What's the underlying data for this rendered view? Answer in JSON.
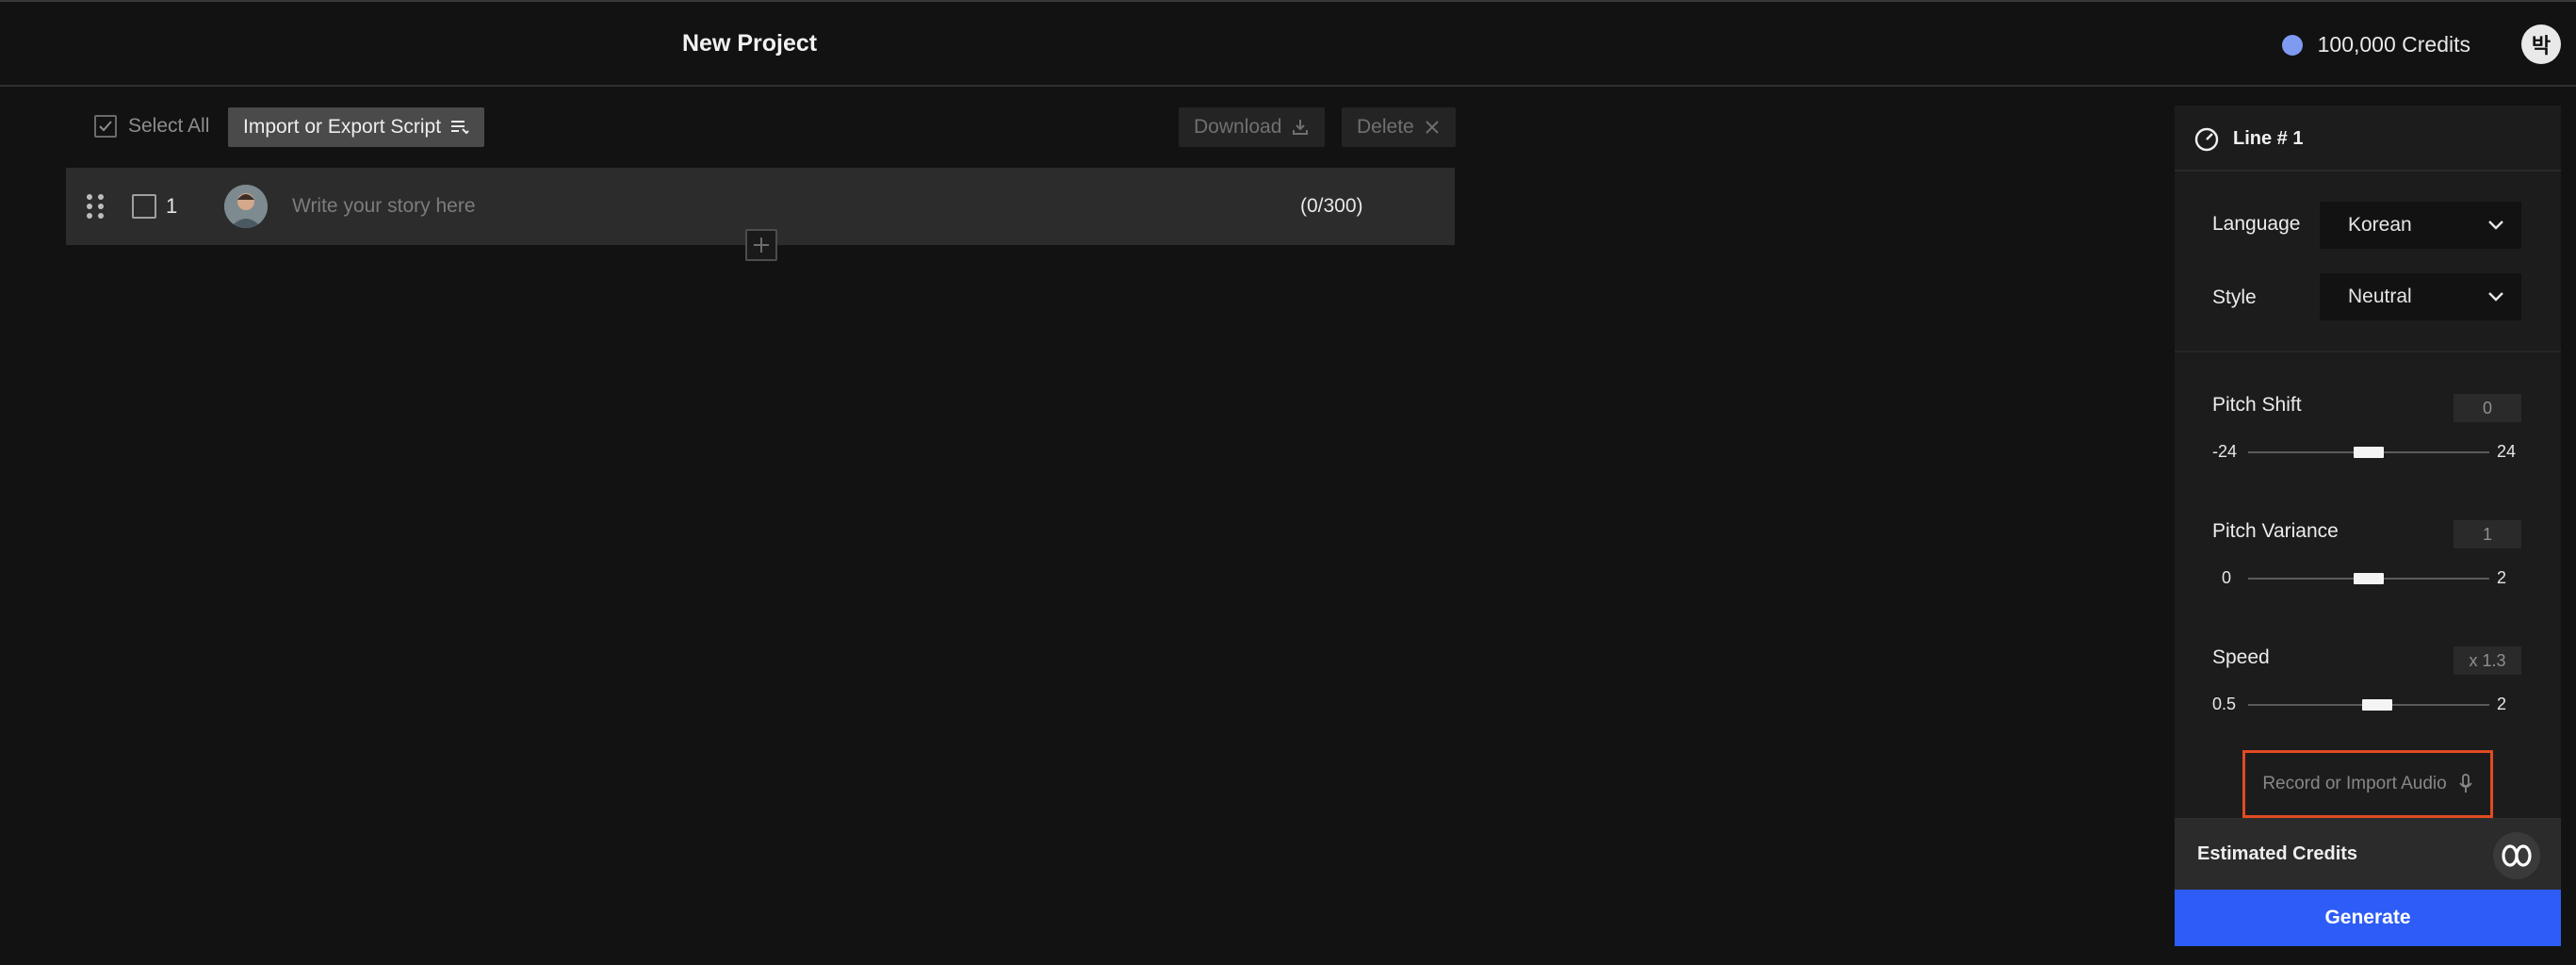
{
  "header": {
    "project_title": "New Project",
    "credits_label": "100,000 Credits",
    "user_initial": "박",
    "credit_color": "#7f9bf1"
  },
  "toolbar": {
    "select_all_label": "Select All",
    "import_export_label": "Import or Export Script",
    "download_label": "Download",
    "delete_label": "Delete"
  },
  "script": {
    "rows": [
      {
        "number": "1",
        "placeholder": "Write your story here",
        "char_count": "(0/300)"
      }
    ]
  },
  "panel": {
    "line_title": "Line # 1",
    "language": {
      "label": "Language",
      "value": "Korean"
    },
    "style": {
      "label": "Style",
      "value": "Neutral"
    },
    "sliders": [
      {
        "label": "Pitch Shift",
        "value_text": "0",
        "min_label": "-24",
        "max_label": "24",
        "min": -24,
        "max": 24,
        "value": 0
      },
      {
        "label": "Pitch Variance",
        "value_text": "1",
        "min_label": "0",
        "max_label": "2",
        "min": 0,
        "max": 2,
        "value": 1
      },
      {
        "label": "Speed",
        "value_text": "x 1.3",
        "min_label": "0.5",
        "max_label": "2",
        "min": 0.5,
        "max": 2,
        "value": 1.3
      }
    ],
    "record_import_label": "Record or Import Audio",
    "estimated_credits_label": "Estimated Credits",
    "generate_label": "Generate",
    "accent_color": "#2d5cf6",
    "highlight_color": "#e14a22"
  }
}
